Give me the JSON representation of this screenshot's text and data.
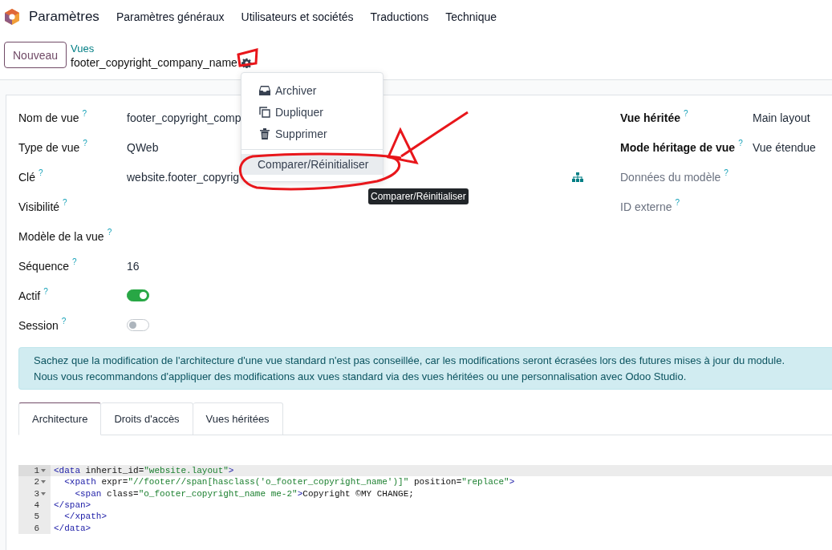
{
  "app": {
    "name": "Paramètres"
  },
  "menu": [
    {
      "label": "Paramètres généraux"
    },
    {
      "label": "Utilisateurs et sociétés"
    },
    {
      "label": "Traductions"
    },
    {
      "label": "Technique"
    }
  ],
  "new_button": "Nouveau",
  "breadcrumb": {
    "parent": "Vues",
    "current": "footer_copyright_company_name"
  },
  "actions_menu": {
    "groups": [
      [
        {
          "label": "Archiver",
          "kind": "archive",
          "selected": false
        },
        {
          "label": "Dupliquer",
          "kind": "copy",
          "selected": false
        },
        {
          "label": "Supprimer",
          "kind": "delete",
          "selected": false
        }
      ],
      [
        {
          "label": "Comparer/Réinitialiser",
          "kind": "plain",
          "selected": true
        }
      ]
    ]
  },
  "tooltip": "Comparer/Réinitialiser",
  "form": {
    "left": [
      {
        "label": "Nom de vue",
        "help": "?",
        "kind": "text",
        "value": "footer_copyright_comp"
      },
      {
        "label": "Type de vue",
        "help": "?",
        "kind": "text",
        "value": "QWeb"
      },
      {
        "label": "Clé",
        "help": "?",
        "kind": "text",
        "value": "website.footer_copyrig"
      },
      {
        "label": "Visibilité",
        "help": "?",
        "kind": "empty"
      },
      {
        "label": "Modèle de la vue",
        "help": "?",
        "kind": "empty"
      },
      {
        "label": "Séquence",
        "help": "?",
        "kind": "text",
        "value": "16"
      },
      {
        "label": "Actif",
        "help": "?",
        "kind": "toggle",
        "on": true
      },
      {
        "label": "Session",
        "help": "?",
        "kind": "toggle",
        "on": false
      }
    ],
    "right": [
      {
        "label": "Vue héritée",
        "help": "?",
        "value": "Main layout",
        "muted": false,
        "kind": "plain"
      },
      {
        "label": "Mode héritage de vue",
        "help": "?",
        "value": "Vue étendue",
        "muted": false,
        "kind": "plain"
      },
      {
        "label": "Données du modèle",
        "help": "?",
        "muted": true,
        "kind": "hierarchy"
      },
      {
        "label": "ID externe",
        "help": "?",
        "muted": true,
        "kind": "plain"
      }
    ]
  },
  "alert": {
    "lines": [
      "Sachez que la modification de l'architecture d'une vue standard n'est pas conseillée, car les modifications seront écrasées lors des futures mises à jour du module.",
      "Nous vous recommandons d'appliquer des modifications aux vues standard via des vues héritées ou une personnalisation avec Odoo Studio."
    ]
  },
  "tabs": [
    {
      "label": "Architecture",
      "selected": true
    },
    {
      "label": "Droits d'accès",
      "selected": false
    },
    {
      "label": "Vues héritées",
      "selected": false
    }
  ],
  "code": {
    "lines": [
      {
        "number": "1",
        "fold": true,
        "active": true,
        "tokens": [
          {
            "kind": "tag",
            "text": "<data"
          },
          {
            "kind": "attr",
            "text": " inherit_id="
          },
          {
            "kind": "string",
            "text": "\"website.layout\""
          },
          {
            "kind": "tag",
            "text": ">"
          }
        ]
      },
      {
        "number": "2",
        "fold": true,
        "active": false,
        "tokens": [
          {
            "kind": "tag",
            "text": "  <xpath"
          },
          {
            "kind": "attr",
            "text": " expr="
          },
          {
            "kind": "string",
            "text": "\"//footer//span[hasclass('o_footer_copyright_name')]\""
          },
          {
            "kind": "attr",
            "text": " position="
          },
          {
            "kind": "string",
            "text": "\"replace\""
          },
          {
            "kind": "tag",
            "text": ">"
          }
        ]
      },
      {
        "number": "3",
        "fold": true,
        "active": false,
        "tokens": [
          {
            "kind": "tag",
            "text": "    <span"
          },
          {
            "kind": "attr",
            "text": " class="
          },
          {
            "kind": "string",
            "text": "\"o_footer_copyright_name me-2\""
          },
          {
            "kind": "tag",
            "text": ">"
          },
          {
            "kind": "text",
            "text": "Copyright ©MY CHANGE;"
          }
        ]
      },
      {
        "number": "4",
        "fold": false,
        "active": false,
        "tokens": [
          {
            "kind": "tag",
            "text": "</span>"
          }
        ]
      },
      {
        "number": "5",
        "fold": false,
        "active": false,
        "tokens": [
          {
            "kind": "tag",
            "text": "  </xpath>"
          }
        ]
      },
      {
        "number": "6",
        "fold": false,
        "active": false,
        "tokens": [
          {
            "kind": "tag",
            "text": "</data>"
          }
        ]
      }
    ]
  }
}
